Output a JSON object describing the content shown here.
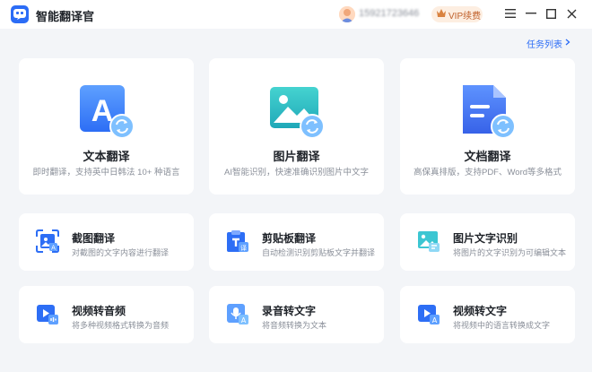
{
  "app": {
    "title": "智能翻译官"
  },
  "user": {
    "phone": "15921723646"
  },
  "header": {
    "vip_label": "VIP续费",
    "task_list_label": "任务列表"
  },
  "big_cards": [
    {
      "title": "文本翻译",
      "desc": "即时翻译，支持英中日韩法 10+ 种语言",
      "icon": "text-translate-icon"
    },
    {
      "title": "图片翻译",
      "desc": "AI智能识别，快速准确识别图片中文字",
      "icon": "image-translate-icon"
    },
    {
      "title": "文档翻译",
      "desc": "高保真排版，支持PDF、Word等多格式",
      "icon": "document-translate-icon"
    }
  ],
  "small_cards": [
    {
      "title": "截图翻译",
      "desc": "对截图的文字内容进行翻译",
      "icon": "screenshot-translate-icon"
    },
    {
      "title": "剪贴板翻译",
      "desc": "自动检测识别剪贴板文字并翻译",
      "icon": "clipboard-translate-icon"
    },
    {
      "title": "图片文字识别",
      "desc": "将图片的文字识别为可编辑文本",
      "icon": "image-ocr-icon"
    },
    {
      "title": "视频转音频",
      "desc": "将多种视频格式转换为音频",
      "icon": "video-to-audio-icon"
    },
    {
      "title": "录音转文字",
      "desc": "将音频转换为文本",
      "icon": "audio-to-text-icon"
    },
    {
      "title": "视频转文字",
      "desc": "将视频中的语言转换成文字",
      "icon": "video-to-text-icon"
    }
  ],
  "colors": {
    "accent": "#2b6cf6",
    "background": "#f3f5f8",
    "vip": "#c0602a"
  }
}
